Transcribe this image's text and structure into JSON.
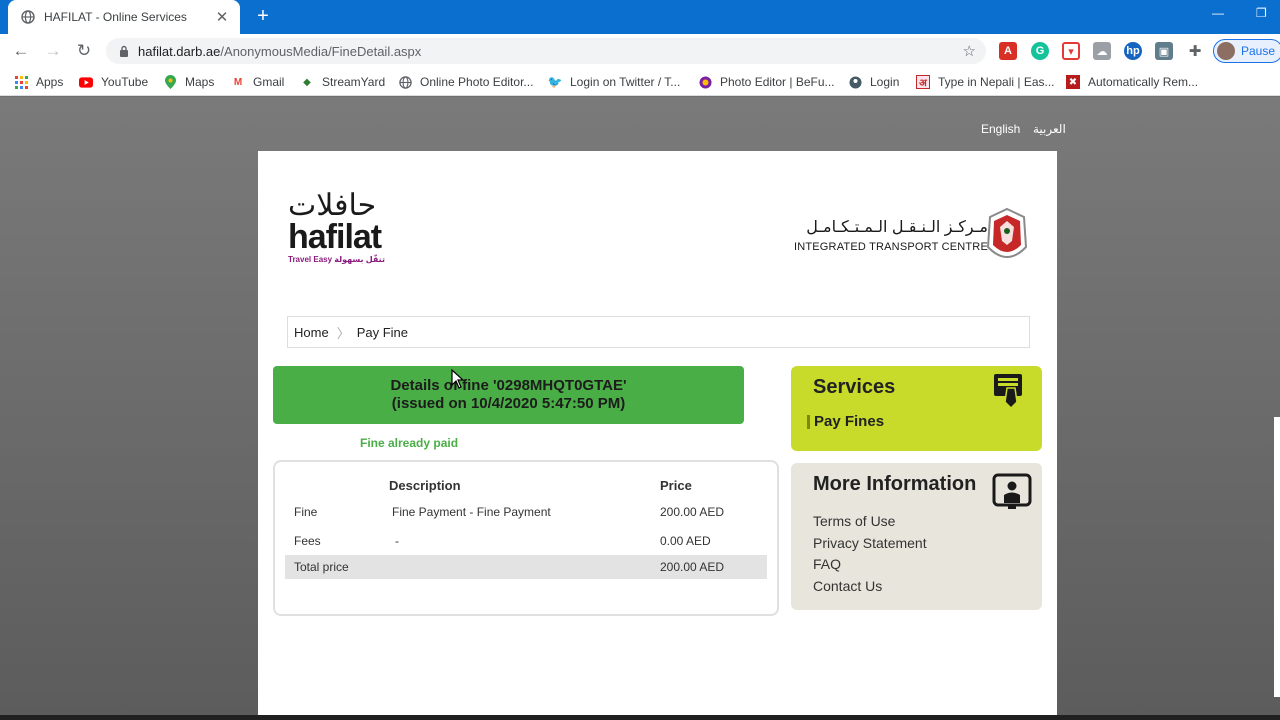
{
  "browser": {
    "tab_title": "HAFILAT - Online Services",
    "new_tab": "+",
    "url_domain": "hafilat.darb.ae",
    "url_path": "/AnonymousMedia/FineDetail.aspx",
    "profile_label": "Pause",
    "bookmarks": [
      {
        "label": "Apps",
        "icon": "apps-grid-icon",
        "color": "#ea4335"
      },
      {
        "label": "YouTube",
        "icon": "youtube-icon",
        "color": "#ff0000"
      },
      {
        "label": "Maps",
        "icon": "maps-pin-icon",
        "color": "#34a853"
      },
      {
        "label": "Gmail",
        "icon": "gmail-icon",
        "color": "#ea4335"
      },
      {
        "label": "StreamYard",
        "icon": "streamyard-icon",
        "color": "#2e7d32"
      },
      {
        "label": "Online Photo Editor...",
        "icon": "globe-icon",
        "color": "#5f6368"
      },
      {
        "label": "Login on Twitter / T...",
        "icon": "twitter-icon",
        "color": "#1da1f2"
      },
      {
        "label": "Photo Editor | BeFu...",
        "icon": "befunky-icon",
        "color": "#7b1fa2"
      },
      {
        "label": "Login",
        "icon": "login-icon",
        "color": "#455a64"
      },
      {
        "label": "Type in Nepali | Eas...",
        "icon": "nepali-icon",
        "color": "#c62828"
      },
      {
        "label": "Automatically Rem...",
        "icon": "remove-icon",
        "color": "#b71c1c"
      }
    ]
  },
  "page": {
    "lang_english": "English",
    "lang_arabic": "العربية",
    "logo_left": {
      "arabic": "حافلات",
      "english": "hafilat",
      "tagline": "Travel Easy تنقّل بسهولة"
    },
    "logo_right": {
      "arabic": "مـركـز الـنـقـل الـمـتـكـامـل",
      "english": "INTEGRATED TRANSPORT CENTRE"
    },
    "breadcrumb": {
      "home": "Home",
      "current": "Pay Fine"
    },
    "fine": {
      "header_line1": "Details of fine '0298MHQT0GTAE'",
      "header_line2": "(issued on 10/4/2020 5:47:50 PM)",
      "status": "Fine already paid",
      "col_description": "Description",
      "col_price": "Price",
      "rows": [
        {
          "label": "Fine",
          "description": "Fine Payment -  Fine Payment",
          "price": "200.00 AED"
        },
        {
          "label": "Fees",
          "description": "-",
          "price": "0.00 AED"
        }
      ],
      "total_label": "Total price",
      "total_price": "200.00 AED"
    },
    "services": {
      "title": "Services",
      "link": "Pay Fines"
    },
    "more_info": {
      "title": "More Information",
      "links": [
        "Terms of Use",
        "Privacy Statement",
        "FAQ",
        "Contact Us"
      ]
    }
  },
  "colors": {
    "chrome_blue": "#0a6fcf",
    "fine_green": "#4aae47",
    "services_lime": "#c8da2a",
    "info_beige": "#e8e6dc"
  }
}
